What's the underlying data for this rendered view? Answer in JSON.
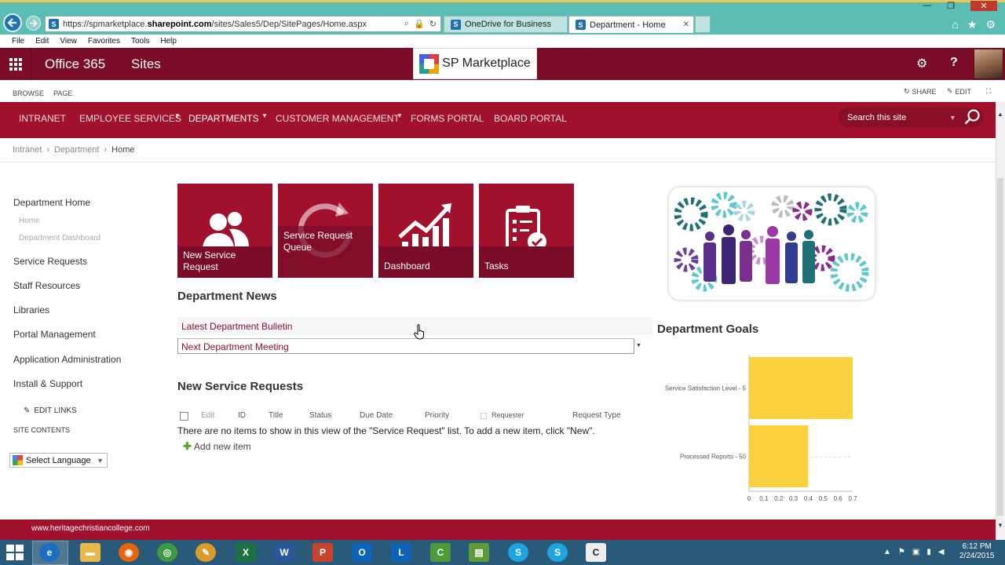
{
  "browser": {
    "url_prefix": "https://spmarketplace.",
    "url_domain": "sharepoint.com",
    "url_path": "/sites/Sales5/Dep/SitePages/Home.aspx",
    "tabs": [
      {
        "label": "OneDrive for Business",
        "active": false
      },
      {
        "label": "Department - Home",
        "active": true
      }
    ],
    "menu": [
      "File",
      "Edit",
      "View",
      "Favorites",
      "Tools",
      "Help"
    ]
  },
  "suitebar": {
    "brand": "Office 365",
    "app": "Sites",
    "logo_text": "SP Marketplace"
  },
  "ribbon": {
    "tabs": [
      "BROWSE",
      "PAGE"
    ],
    "share_label": "SHARE",
    "edit_label": "EDIT"
  },
  "topnav": {
    "items": [
      "INTRANET",
      "EMPLOYEE SERVICES",
      "DEPARTMENTS",
      "CUSTOMER MANAGEMENT",
      "FORMS PORTAL",
      "BOARD PORTAL"
    ],
    "active": "DEPARTMENTS",
    "search_placeholder": "Search this site"
  },
  "breadcrumb": [
    "Intranet",
    "Department",
    "Home"
  ],
  "leftnav": {
    "heading": "Department Home",
    "sub_items": [
      "Home",
      "Department Dashboard"
    ],
    "items": [
      "Service Requests",
      "Staff Resources",
      "Libraries",
      "Portal Management",
      "Application Administration",
      "Install & Support"
    ],
    "edit_links": "EDIT LINKS",
    "site_contents": "SITE CONTENTS",
    "language": "Select Language"
  },
  "tiles": [
    {
      "label_line1": "New Service",
      "label_line2": "Request",
      "icon": "users-icon"
    },
    {
      "label_line1": "Service Request",
      "label_line2": "Queue",
      "icon": "refresh-icon"
    },
    {
      "label_line1": "Dashboard",
      "label_line2": "",
      "icon": "chart-growth-icon"
    },
    {
      "label_line1": "Tasks",
      "label_line2": "",
      "icon": "clipboard-check-icon"
    }
  ],
  "news": {
    "title": "Department News",
    "items": [
      "Latest Department Bulletin",
      "Next Department Meeting"
    ]
  },
  "requests": {
    "title": "New Service Requests",
    "columns": [
      "Edit",
      "ID",
      "Title",
      "Status",
      "Due Date",
      "Priority",
      "Requester",
      "Request Type"
    ],
    "empty_message": "There are no items to show in this view of the \"Service Request\" list. To add a new item, click \"New\".",
    "add_label": "Add new item"
  },
  "goals": {
    "title": "Department Goals"
  },
  "chart_data": {
    "type": "bar",
    "orientation": "horizontal",
    "categories": [
      "Service Satisfaction Level - 5",
      "Processed Reports - 50"
    ],
    "values": [
      0.7,
      0.4
    ],
    "xlim": [
      0,
      0.7
    ],
    "xticks": [
      "0",
      "0.1",
      "0.2",
      "0.3",
      "0.4",
      "0.5",
      "0.6",
      "0.7"
    ],
    "bar_color": "#fcd13f"
  },
  "footer": {
    "url": "www.heritagechristiancollege.com"
  },
  "taskbar": {
    "time": "6:12 PM",
    "date": "2/24/2015"
  },
  "colors": {
    "suite": "#7a0c27",
    "nav": "#a1112e",
    "accent_text": "#8a1029"
  }
}
